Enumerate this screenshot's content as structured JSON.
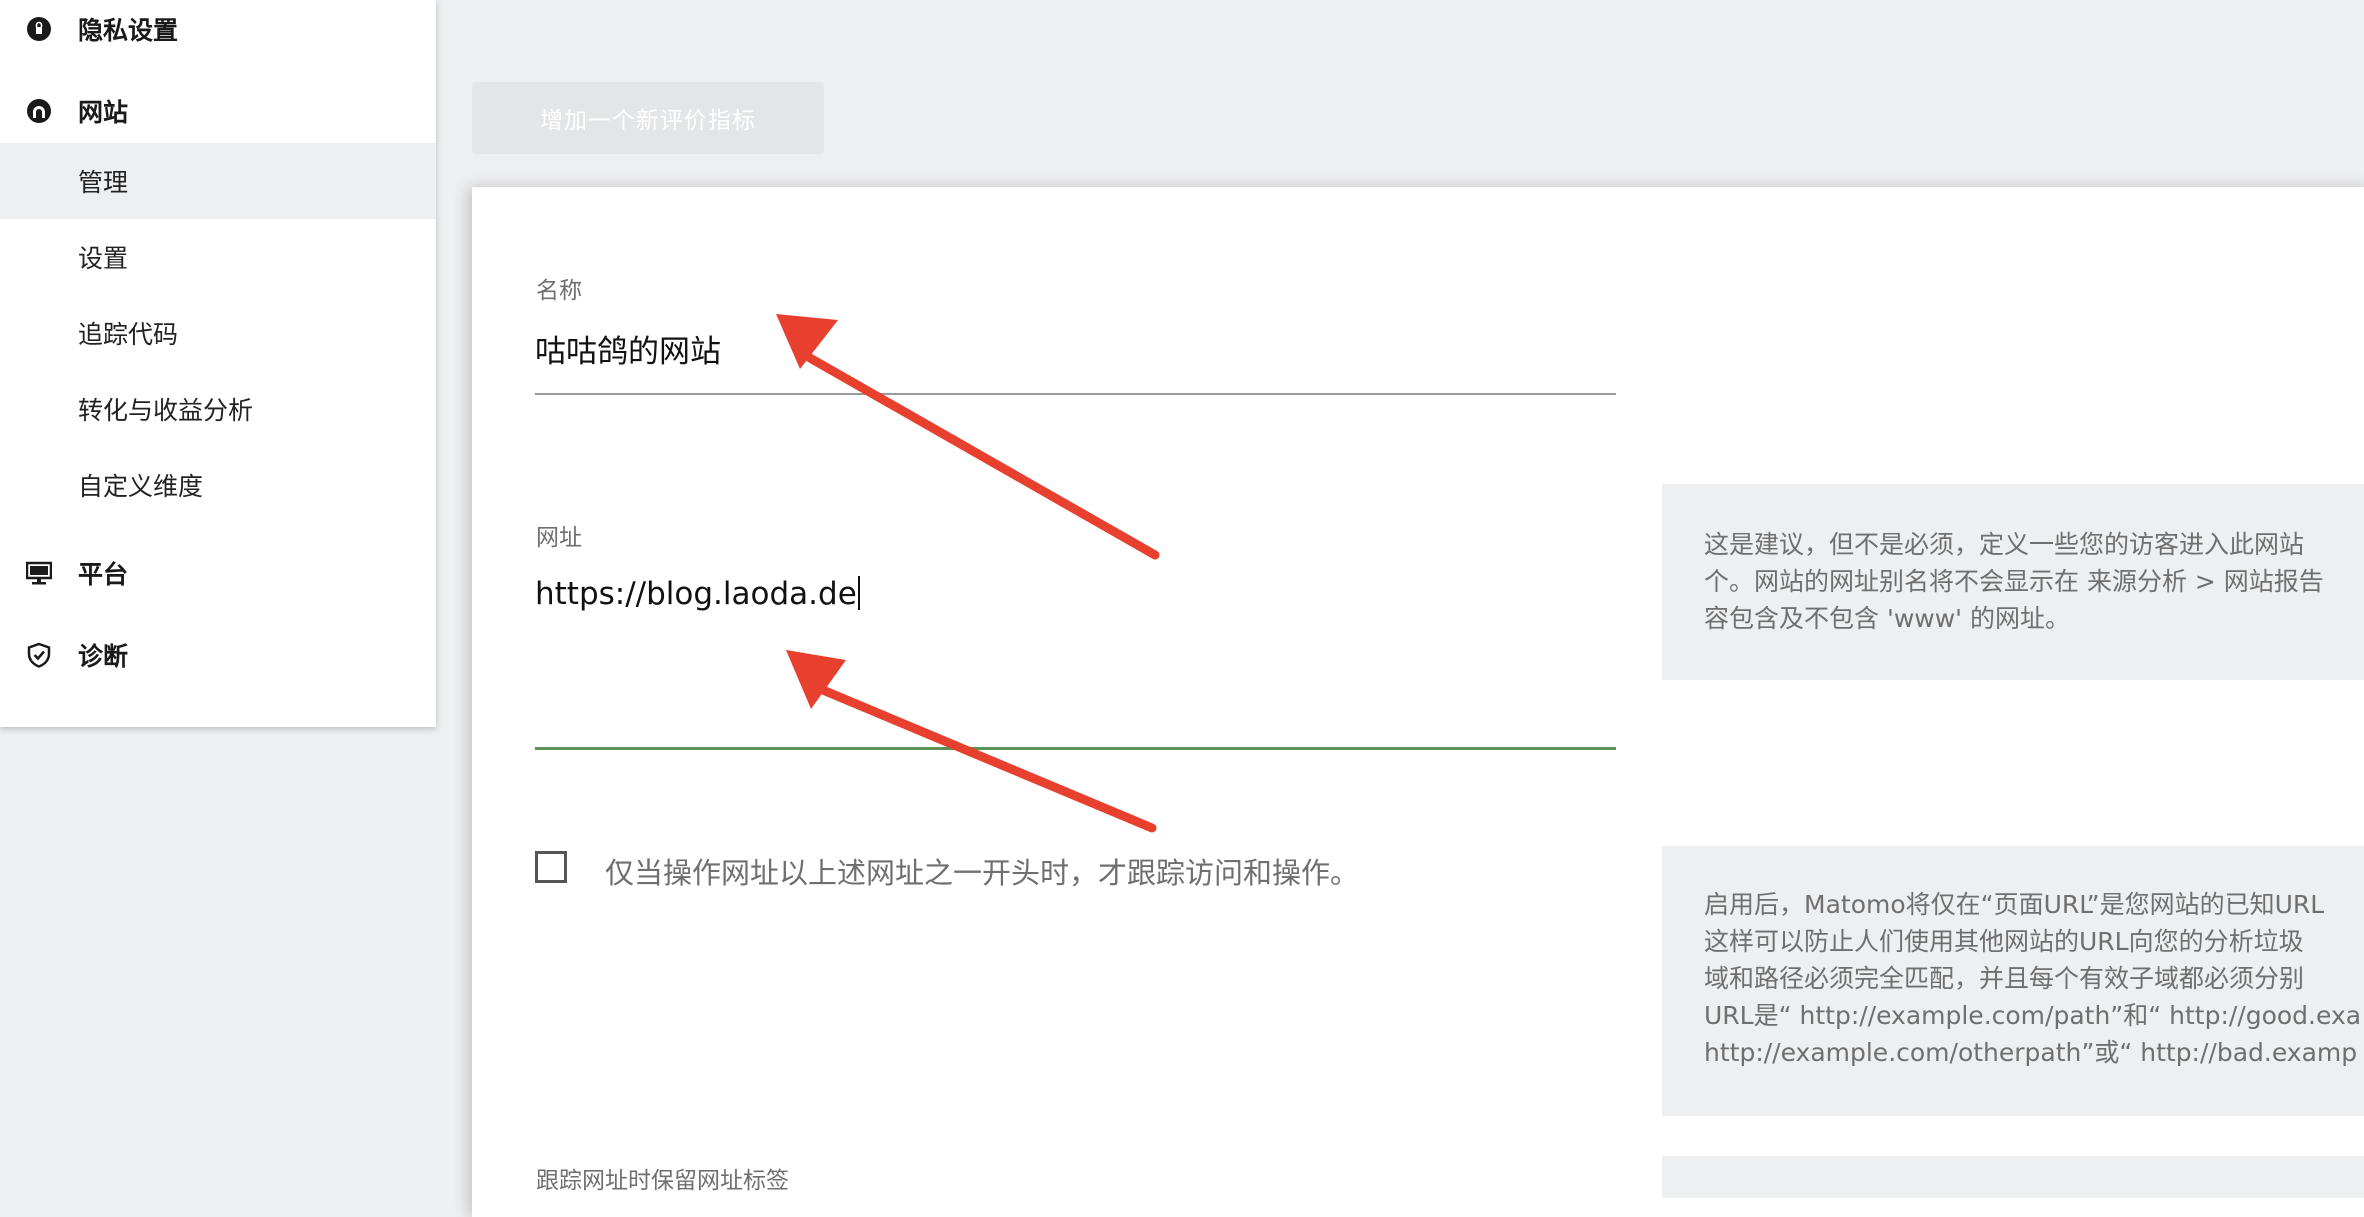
{
  "sidebar": {
    "categories": [
      {
        "label": "隐私设置",
        "icon": "lock-icon"
      },
      {
        "label": "网站",
        "icon": "globe-icon"
      },
      {
        "label": "平台",
        "icon": "monitor-icon"
      },
      {
        "label": "诊断",
        "icon": "shield-icon"
      }
    ],
    "website_items": [
      {
        "label": "管理",
        "active": true
      },
      {
        "label": "设置",
        "active": false
      },
      {
        "label": "追踪代码",
        "active": false
      },
      {
        "label": "转化与收益分析",
        "active": false
      },
      {
        "label": "自定义维度",
        "active": false
      }
    ]
  },
  "toolbar": {
    "add_metric_label": "增加一个新评价指标"
  },
  "form": {
    "name": {
      "label": "名称",
      "value": "咕咕鸽的网站"
    },
    "url": {
      "label": "网址",
      "value": "https://blog.laoda.de"
    },
    "url_help": [
      "这是建议，但不是必须，定义一些您的访客进入此网站",
      "个。网站的网址别名将不会显示在 来源分析 > 网站报告",
      "容包含及不包含 'www' 的网址。"
    ],
    "exclude_unknown": {
      "label": "仅当操作网址以上述网址之一开头时，才跟踪访问和操作。",
      "checked": false
    },
    "exclude_help": [
      "启用后，Matomo将仅在“页面URL”是您网站的已知URL",
      "这样可以防止人们使用其他网站的URL向您的分析垃圾",
      "域和路径必须完全匹配，并且每个有效子域都必须分别",
      "URL是“ http://example.com/path”和“ http://good.exa",
      "http://example.com/otherpath”或“ http://bad.examp"
    ],
    "keep_fragments": {
      "label": "跟踪网址时保留网址标签"
    }
  },
  "colors": {
    "accent_green": "#5a9355",
    "annotation_red": "#e8402f"
  }
}
